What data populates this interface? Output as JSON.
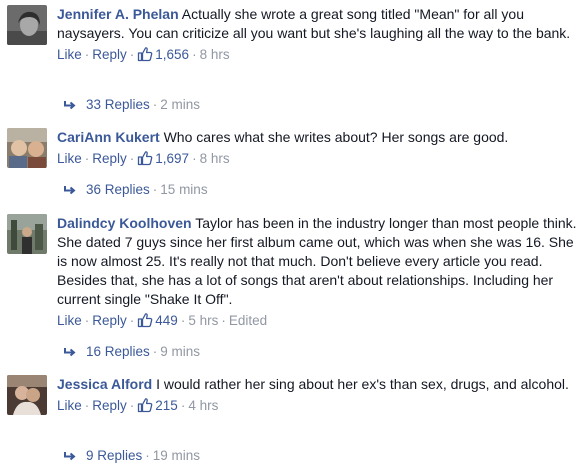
{
  "comments": [
    {
      "author": "Jennifer A. Phelan",
      "text": "Actually she wrote a great song titled \"Mean\" for all you naysayers. You can criticize all you want but she's laughing all the way to the bank.",
      "like_label": "Like",
      "reply_label": "Reply",
      "likes": "1,656",
      "time": "8 hrs",
      "edited": "",
      "replies_label": "33 Replies",
      "replies_time": "2 mins",
      "avatar_colors": [
        "#5a5a5a",
        "#9a9a9a"
      ]
    },
    {
      "author": "CariAnn Kukert",
      "text": "Who cares what she writes about? Her songs are good.",
      "like_label": "Like",
      "reply_label": "Reply",
      "likes": "1,697",
      "time": "8 hrs",
      "edited": "",
      "replies_label": "36 Replies",
      "replies_time": "15 mins",
      "avatar_colors": [
        "#7a6a5a",
        "#c7a88a"
      ]
    },
    {
      "author": "Dalindcy Koolhoven",
      "text": "Taylor has been in the industry longer than most people think. She dated 7 guys since her first album came out, which was when she was 16. She is now almost 25. It's really not that much. Don't believe every article you read. Besides that, she has a lot of songs that aren't about relationships. Including her current single \"Shake It Off\".",
      "like_label": "Like",
      "reply_label": "Reply",
      "likes": "449",
      "time": "5 hrs",
      "edited": "Edited",
      "replies_label": "16 Replies",
      "replies_time": "9 mins",
      "avatar_colors": [
        "#4e5b4a",
        "#8a8f86"
      ]
    },
    {
      "author": "Jessica Alford",
      "text": "I would rather her sing about her ex's than sex, drugs, and alcohol.",
      "like_label": "Like",
      "reply_label": "Reply",
      "likes": "215",
      "time": "4 hrs",
      "edited": "",
      "replies_label": "9 Replies",
      "replies_time": "19 mins",
      "avatar_colors": [
        "#3c2f2a",
        "#b08a70"
      ]
    }
  ],
  "colors": {
    "link": "#3b5998",
    "meta": "#9197a3",
    "text": "#141823"
  },
  "icons": {
    "like": "thumbs-up-icon",
    "reply": "reply-arrow-icon"
  }
}
